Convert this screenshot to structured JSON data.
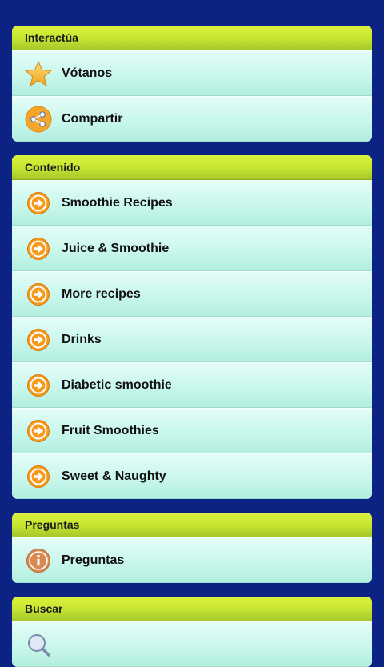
{
  "sections": [
    {
      "title": "Interactúa",
      "items": [
        {
          "label": "Vótanos",
          "icon": "star-icon"
        },
        {
          "label": "Compartir",
          "icon": "share-icon"
        }
      ]
    },
    {
      "title": "Contenido",
      "items": [
        {
          "label": "Smoothie Recipes",
          "icon": "arrow-right-icon"
        },
        {
          "label": "Juice & Smoothie",
          "icon": "arrow-right-icon"
        },
        {
          "label": "More recipes",
          "icon": "arrow-right-icon"
        },
        {
          "label": "Drinks",
          "icon": "arrow-right-icon"
        },
        {
          "label": "Diabetic smoothie",
          "icon": "arrow-right-icon"
        },
        {
          "label": "Fruit Smoothies",
          "icon": "arrow-right-icon"
        },
        {
          "label": "Sweet & Naughty",
          "icon": "arrow-right-icon"
        }
      ]
    },
    {
      "title": "Preguntas",
      "items": [
        {
          "label": "Preguntas",
          "icon": "info-icon"
        }
      ]
    },
    {
      "title": "Buscar",
      "items": [
        {
          "label": "",
          "icon": "search-icon"
        }
      ]
    }
  ],
  "colors": {
    "background": "#0d2383",
    "header": "#c8e632",
    "item": "#c9f7ec",
    "icon_orange": "#f29a1a"
  }
}
